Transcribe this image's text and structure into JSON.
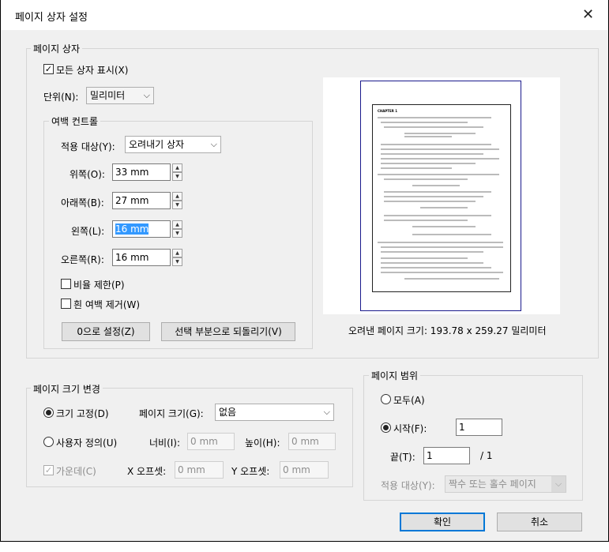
{
  "dialog": {
    "title": "페이지 상자 설정"
  },
  "page_boxes": {
    "legend": "페이지 상자",
    "show_all_label": "모든 상자 표시(X)",
    "show_all_checked": true,
    "unit_label": "단위(N):",
    "unit_value": "밀리미터"
  },
  "margins": {
    "legend": "여백 컨트롤",
    "apply_to_label": "적용 대상(Y):",
    "apply_to_value": "오려내기 상자",
    "top_label": "위쪽(O):",
    "top_value": "33 mm",
    "bottom_label": "아래쪽(B):",
    "bottom_value": "27 mm",
    "left_label": "왼쪽(L):",
    "left_value": "16 mm",
    "right_label": "오른쪽(R):",
    "right_value": "16 mm",
    "constrain_label": "비율 제한(P)",
    "remove_white_label": "흰 여백 제거(W)",
    "zero_button": "0으로 설정(Z)",
    "revert_button": "선택 부분으로 되돌리기(V)"
  },
  "preview": {
    "cropped_size_label": "오려낸 페이지 크기: 193.78 x 259.27 밀리미터",
    "chapter_text": "CHAPTER 1"
  },
  "page_size": {
    "legend": "페이지 크기 변경",
    "fixed_label": "크기 고정(D)",
    "page_size_label": "페이지 크기(G):",
    "page_size_value": "없음",
    "custom_label": "사용자 정의(U)",
    "width_label": "너비(I):",
    "width_value": "0 mm",
    "height_label": "높이(H):",
    "height_value": "0 mm",
    "center_label": "가운데(C)",
    "x_offset_label": "X 오프셋:",
    "x_offset_value": "0 mm",
    "y_offset_label": "Y 오프셋:",
    "y_offset_value": "0 mm"
  },
  "page_range": {
    "legend": "페이지 범위",
    "all_label": "모두(A)",
    "from_label": "시작(F):",
    "from_value": "1",
    "to_label": "끝(T):",
    "to_value": "1",
    "total": "/ 1",
    "apply_to_label": "적용 대상(Y):",
    "apply_to_value": "짝수 또는 홀수 페이지"
  },
  "footer": {
    "ok_button": "확인",
    "cancel_button": "취소"
  },
  "colors": {
    "accent": "#0078d7",
    "selection": "#3399ff",
    "preview_border": "#1a1a8c"
  }
}
